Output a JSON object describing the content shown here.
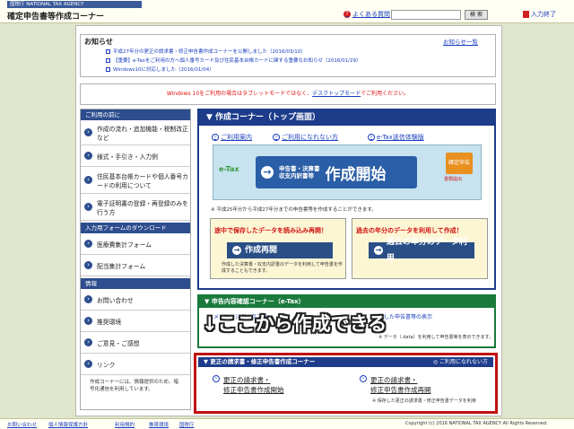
{
  "header": {
    "agency_label": "国税庁 NATIONAL TAX AGENCY",
    "site_title": "確定申告書等作成コーナー",
    "faq_link": "よくある質問",
    "search_button": "検 索",
    "exit_link": "入力終了"
  },
  "notice": {
    "title": "お知らせ",
    "list_link": "お知らせ一覧",
    "items": [
      "平成27年分の更正の請求書・修正申告書作成コーナーを公開しました（2016/03/10）",
      "【重要】e-Taxをご利用の方へ個人番号カード及び住民基本台帳カードに関する重要なお知らせ（2016/01/29）",
      "Windows10に対応しました（2016/01/04）"
    ]
  },
  "windows_banner": {
    "prefix": "Windows 10をご利用の場合はタブレットモードではなく、",
    "link": "デスクトップモード",
    "suffix": "でご利用ください。"
  },
  "sidebar": {
    "section1": "ご利用の前に",
    "items1": [
      "作成の流れ・追加機能・税制改正など",
      "様式・手引き・入力例",
      "住民基本台帳カードや個人番号カードの利用について",
      "電子証明書の登録・再登録のみを行う方"
    ],
    "section2": "入力用フォームのダウンロード",
    "items2": [
      "医療費集計フォーム",
      "配当集計フォーム"
    ],
    "section3": "情報",
    "items3": [
      "お問い合わせ",
      "推奨環境",
      "ご意見・ご感想",
      "リンク"
    ],
    "note": "作成コーナーには、情報提供のため、暗号化通信を利用しています。"
  },
  "sakusei": {
    "header": "▼ 作成コーナー（トップ画面）",
    "links": [
      "ご利用案内",
      "ご利用になれない方",
      "e-Tax送信体験版"
    ],
    "start_sub1": "申告書・決算書",
    "start_sub2": "収支内訳書等",
    "start_main": "作成開始",
    "etax_logo": "e-Tax",
    "app_logo": "確定申告",
    "app_logo_label": "書類提出",
    "note": "※ 平成25年分から平成27年分までの申告書等を作成することができます。",
    "resume_title": "途中で保存したデータを読み込み再開！",
    "resume_button": "作成再開",
    "resume_desc": "作成した決算書・収支内訳書のデータを利用して申告書を作成することもできます。",
    "past_title": "過去の年分のデータを利用して作成！",
    "past_button": "過去の年分のデータ利用"
  },
  "kakunin": {
    "header": "▼ 申告内容確認コーナー（e-Tax）",
    "left": "メッセージボックス等",
    "right": "送信した申告書等の表示",
    "note": "※ データ（.data）を利用して申告書等を表示できます。"
  },
  "overlay": "↓ここから作成できる",
  "kosei": {
    "header": "▼ 更正の請求書・修正申告書作成コーナー",
    "header_right": "◎ ご利用になれない方",
    "item1_line1": "更正の請求書・",
    "item1_line2": "修正申告書作成開始",
    "item2_line1": "更正の請求書・",
    "item2_line2": "修正申告書作成再開",
    "note": "※ 保存した更正の請求書・修正申告書データを利用"
  },
  "footer": {
    "links": [
      "お問い合わせ",
      "個人情報保護方針",
      "利用規約",
      "推奨環境",
      "国税庁"
    ],
    "copyright": "Copyright (c) 2016 NATIONAL TAX AGENCY All Rights Reserved."
  }
}
